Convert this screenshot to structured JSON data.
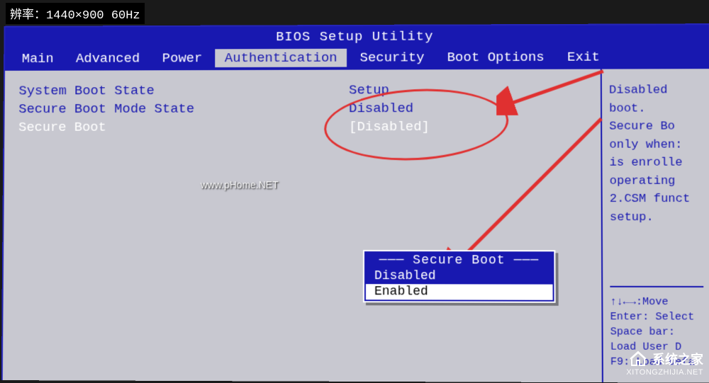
{
  "monitor": {
    "resolution_label": "辨率：1440×900  60Hz"
  },
  "bios": {
    "title": "BIOS Setup Utility",
    "menu": {
      "items": [
        "Main",
        "Advanced",
        "Power",
        "Authentication",
        "Security",
        "Boot Options",
        "Exit"
      ],
      "active_index": 3
    },
    "settings": [
      {
        "label": "System Boot State",
        "value": "Setup",
        "selected": false
      },
      {
        "label": "Secure Boot Mode State",
        "value": "Disabled",
        "selected": false
      },
      {
        "label": "Secure Boot",
        "value": "[Disabled]",
        "selected": true
      }
    ],
    "popup": {
      "title": "Secure Boot",
      "options": [
        "Disabled",
        "Enabled"
      ],
      "highlighted_index": 1
    },
    "help": {
      "lines": [
        "Disabled",
        "boot.",
        "Secure Bo",
        "only when:",
        "is enrolle",
        "operating",
        "2.CSM funct",
        "setup."
      ],
      "footer": [
        "↑↓←→:Move",
        "Enter: Select",
        "Space bar:",
        "Load User D",
        "F9: Load Defa"
      ]
    }
  },
  "watermarks": {
    "center": "www.pHome.NET",
    "corner_cn": "系统之家",
    "corner_url": "XITONGZHIJIA.NET"
  },
  "annotations": {
    "ellipse_color": "#e03030",
    "arrow_color": "#e03030"
  }
}
